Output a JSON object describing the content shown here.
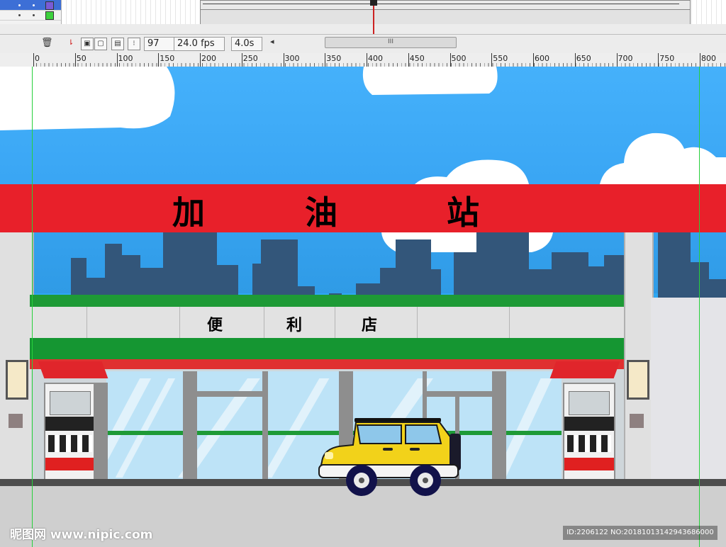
{
  "timeline": {
    "frame_number": "97",
    "frame_rate": "24.0 fps",
    "elapsed_time": "4.0s",
    "scroll_label": "III",
    "scroll_left_glyph": "◂"
  },
  "ruler": {
    "ticks": [
      "0",
      "50",
      "100",
      "150",
      "200",
      "250",
      "300",
      "350",
      "400",
      "450",
      "500",
      "550",
      "600",
      "650",
      "700",
      "750",
      "800"
    ]
  },
  "canopy": {
    "chars": [
      "加",
      "油",
      "站"
    ]
  },
  "store_sign": {
    "chars": [
      "便",
      "利",
      "店"
    ]
  },
  "watermark": {
    "left": "昵图网 www.nipic.com",
    "right": "ID:2206122 NO:20181013142943686000"
  },
  "colors": {
    "sky": "#3aa6f4",
    "canopy_red": "#e8202a",
    "store_green": "#1e9a36",
    "car_yellow": "#f2d21a",
    "guide_green": "#27d03b"
  }
}
